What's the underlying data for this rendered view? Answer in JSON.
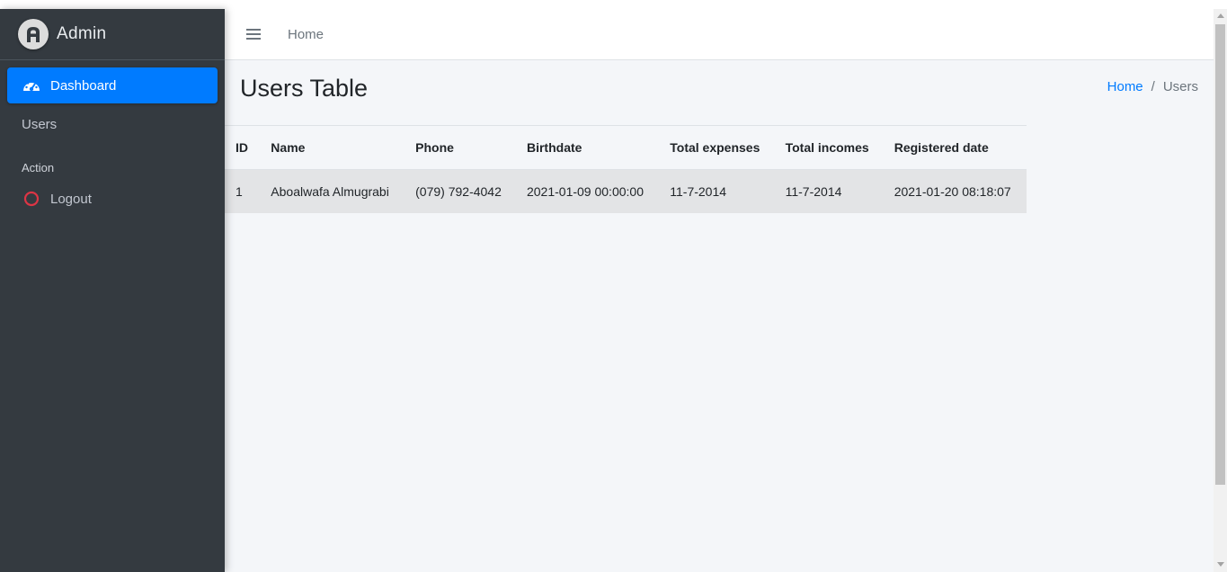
{
  "brand": {
    "title": "Admin"
  },
  "sidebar": {
    "items": [
      {
        "label": "Dashboard",
        "icon": "tachometer-icon",
        "active": true
      },
      {
        "label": "Users"
      }
    ],
    "header": "Action",
    "action_items": [
      {
        "label": "Logout",
        "icon": "circle-outline-icon",
        "icon_color": "#dc3545"
      }
    ]
  },
  "navbar": {
    "home_link": "Home"
  },
  "content": {
    "title": "Users Table",
    "breadcrumb": {
      "home": "Home",
      "separator": "/",
      "current": "Users"
    }
  },
  "table": {
    "columns": [
      "ID",
      "Name",
      "Phone",
      "Birthdate",
      "Total expenses",
      "Total incomes",
      "Registered date"
    ],
    "rows": [
      [
        "1",
        "Aboalwafa Almugrabi",
        "(079) 792-4042",
        "2021-01-09 00:00:00",
        "11-7-2014",
        "11-7-2014",
        "2021-01-20 08:18:07"
      ]
    ]
  },
  "colors": {
    "sidebar_bg": "#343a40",
    "active_bg": "#007bff",
    "link": "#007bff",
    "content_bg": "#f4f6f9"
  }
}
